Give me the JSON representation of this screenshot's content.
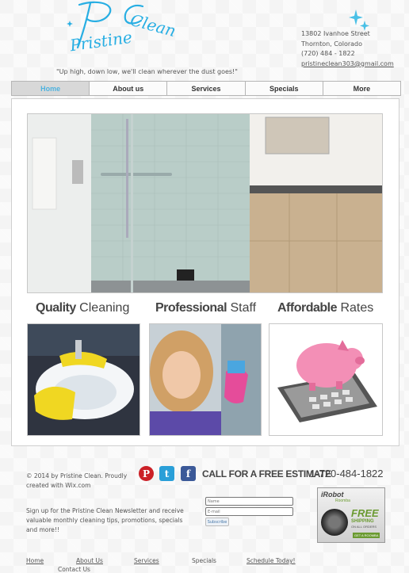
{
  "header": {
    "logo_word1": "Pristine",
    "logo_word2": "Clean",
    "tagline": "\"Up high, down low, we'll clean wherever the dust goes!\"",
    "address_line1": "13802 Ivanhoe Street",
    "address_line2": "Thornton, Colorado",
    "phone": "(720) 484 - 1822",
    "email": "pristineclean303@gmail.com"
  },
  "nav": {
    "items": [
      {
        "label": "Home",
        "active": true
      },
      {
        "label": "About us"
      },
      {
        "label": "Services"
      },
      {
        "label": "Specials"
      },
      {
        "label": "More"
      }
    ]
  },
  "features": [
    {
      "bold": "Quality",
      "rest": " Cleaning"
    },
    {
      "bold": "Professional",
      "rest": " Staff"
    },
    {
      "bold": "Affordable",
      "rest": " Rates"
    }
  ],
  "footer": {
    "copyright": "© 2014 by Pristine Clean. Proudly created with Wix.com",
    "social": [
      {
        "icon": "pinterest-icon",
        "glyph": "P",
        "color": "#cb2027"
      },
      {
        "icon": "twitter-icon",
        "glyph": "t",
        "color": "#2a9fd8"
      },
      {
        "icon": "facebook-icon",
        "glyph": "f",
        "color": "#3b5998"
      }
    ],
    "cta_label": "CALL FOR A FREE ESTIMATE",
    "cta_phone": "1-720-484-1822",
    "newsletter_text": "Sign up for the Pristine Clean Newsletter and receive valuable monthly cleaning tips, promotions, specials and more!!",
    "name_placeholder": "Name",
    "email_placeholder": "E-mail",
    "subscribe_label": "Subscribe",
    "ad": {
      "brand": "iRobot",
      "tag": "Roomba",
      "headline": "FREE",
      "sub1": "SHIPPING",
      "sub2": "ON ALL ORDERS",
      "button": "GET A ROOMBA"
    },
    "links": [
      "Home",
      "About Us",
      "Services",
      "Specials",
      "Schedule Today!"
    ],
    "contact_link": "Contact Us"
  },
  "colors": {
    "accent": "#4fb3df",
    "logo": "#27aee3"
  }
}
